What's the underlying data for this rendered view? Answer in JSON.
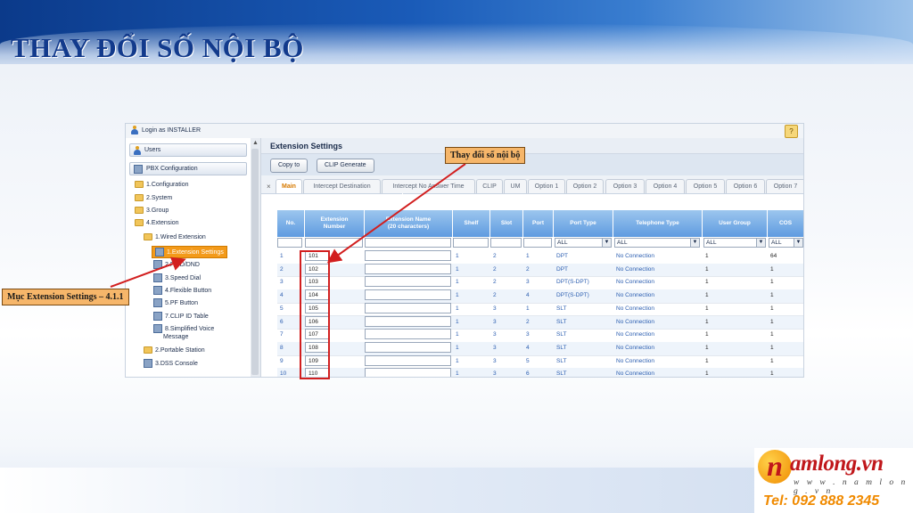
{
  "slide": {
    "title": "THAY ĐỔI SỐ NỘI BỘ",
    "callout_extension_number": "Thay đổi số nội bộ",
    "callout_menu": "Mục Extension Settings – 4.1.1",
    "colors": {
      "title": "#123a8c",
      "highlight": "#d21f1f",
      "callout_bg": "#f6b66a",
      "brand": "#c0171b",
      "tel": "#f08a00"
    }
  },
  "app": {
    "login_text": "Login as INSTALLER",
    "nav_users": "Users",
    "nav_pbx": "PBX Configuration",
    "tree": {
      "configuration": "1.Configuration",
      "system": "2.System",
      "group": "3.Group",
      "extension": "4.Extension",
      "wired_extension": "1.Wired Extension",
      "extension_settings": "1.Extension Settings",
      "fwd_dnd": "2.FWD/DND",
      "speed_dial": "3.Speed Dial",
      "flexible_button": "4.Flexible Button",
      "pf_button": "5.PF Button",
      "clip_id_table": "7.CLIP ID Table",
      "simplified_voice_1": "8.Simplified Voice",
      "simplified_voice_2": "Message",
      "portable_station": "2.Portable Station",
      "dss_console": "3.DSS Console"
    },
    "content_title": "Extension Settings",
    "buttons": {
      "copy_to": "Copy to",
      "clip_generate": "CLIP Generate"
    },
    "tabs": [
      {
        "label": "Main"
      },
      {
        "label": "Intercept Destination"
      },
      {
        "label": "Intercept No Answer Time"
      },
      {
        "label": "CLIP"
      },
      {
        "label": "UM"
      },
      {
        "label": "Option 1"
      },
      {
        "label": "Option 2"
      },
      {
        "label": "Option 3"
      },
      {
        "label": "Option 4"
      },
      {
        "label": "Option 5"
      },
      {
        "label": "Option 6"
      },
      {
        "label": "Option 7"
      }
    ],
    "columns": {
      "no": "No.",
      "ext_number_1": "Extension",
      "ext_number_2": "Number",
      "ext_name_1": "Extension Name",
      "ext_name_2": "(20 characters)",
      "shelf": "Shelf",
      "slot": "Slot",
      "port": "Port",
      "port_type": "Port Type",
      "telephone_type": "Telephone Type",
      "user_group": "User Group",
      "cos": "COS"
    },
    "filters": {
      "port_type": "ALL",
      "telephone_type": "ALL",
      "user_group": "ALL",
      "cos": "ALL"
    },
    "rows": [
      {
        "no": "1",
        "ext": "101",
        "shelf": "1",
        "slot": "2",
        "port": "1",
        "port_type": "DPT",
        "tel_type": "No Connection",
        "user_group": "1",
        "cos": "64"
      },
      {
        "no": "2",
        "ext": "102",
        "shelf": "1",
        "slot": "2",
        "port": "2",
        "port_type": "DPT",
        "tel_type": "No Connection",
        "user_group": "1",
        "cos": "1"
      },
      {
        "no": "3",
        "ext": "103",
        "shelf": "1",
        "slot": "2",
        "port": "3",
        "port_type": "DPT(S-DPT)",
        "tel_type": "No Connection",
        "user_group": "1",
        "cos": "1"
      },
      {
        "no": "4",
        "ext": "104",
        "shelf": "1",
        "slot": "2",
        "port": "4",
        "port_type": "DPT(S-DPT)",
        "tel_type": "No Connection",
        "user_group": "1",
        "cos": "1"
      },
      {
        "no": "5",
        "ext": "105",
        "shelf": "1",
        "slot": "3",
        "port": "1",
        "port_type": "SLT",
        "tel_type": "No Connection",
        "user_group": "1",
        "cos": "1"
      },
      {
        "no": "6",
        "ext": "106",
        "shelf": "1",
        "slot": "3",
        "port": "2",
        "port_type": "SLT",
        "tel_type": "No Connection",
        "user_group": "1",
        "cos": "1"
      },
      {
        "no": "7",
        "ext": "107",
        "shelf": "1",
        "slot": "3",
        "port": "3",
        "port_type": "SLT",
        "tel_type": "No Connection",
        "user_group": "1",
        "cos": "1"
      },
      {
        "no": "8",
        "ext": "108",
        "shelf": "1",
        "slot": "3",
        "port": "4",
        "port_type": "SLT",
        "tel_type": "No Connection",
        "user_group": "1",
        "cos": "1"
      },
      {
        "no": "9",
        "ext": "109",
        "shelf": "1",
        "slot": "3",
        "port": "5",
        "port_type": "SLT",
        "tel_type": "No Connection",
        "user_group": "1",
        "cos": "1"
      },
      {
        "no": "10",
        "ext": "110",
        "shelf": "1",
        "slot": "3",
        "port": "6",
        "port_type": "SLT",
        "tel_type": "No Connection",
        "user_group": "1",
        "cos": "1"
      }
    ]
  },
  "logo": {
    "letter": "n",
    "brand": "amlong.vn",
    "url": "w w w . n a m l o n g . v n",
    "tel": "Tel: 092 888 2345"
  }
}
